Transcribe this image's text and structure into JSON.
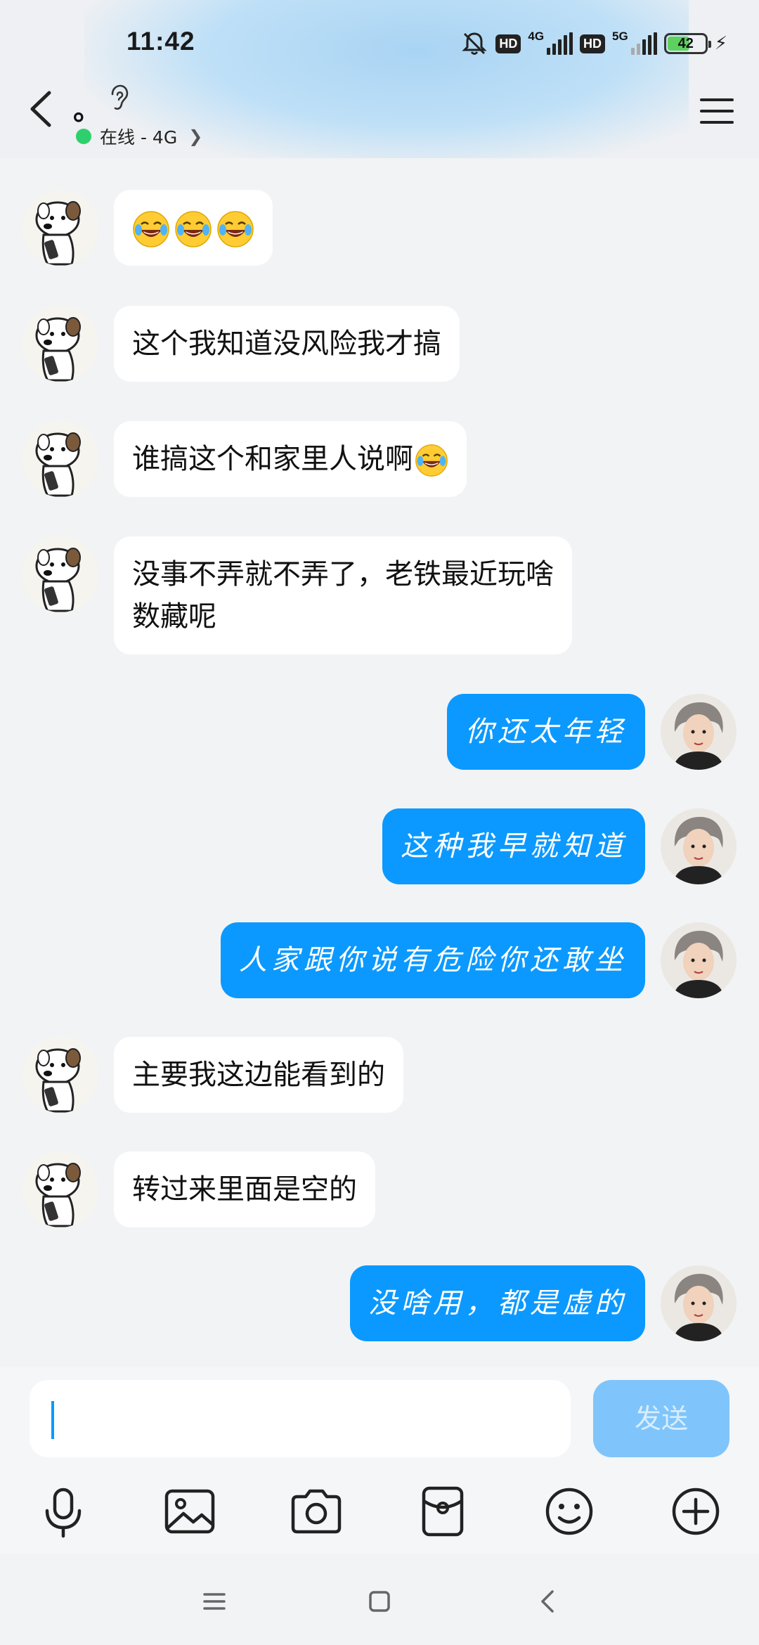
{
  "status_bar": {
    "time": "11:42",
    "hd1": "HD",
    "net1": "4G",
    "hd2": "HD",
    "net2": "5G",
    "battery": "42"
  },
  "header": {
    "title": "。",
    "presence": "在线 - 4G",
    "presence_dot_color": "#2ed06e"
  },
  "messages": [
    {
      "side": "in",
      "text": "",
      "emoji_count": 3,
      "emoji": "face-with-tears-of-joy"
    },
    {
      "side": "in",
      "text": "这个我知道没风险我才搞"
    },
    {
      "side": "in",
      "text": "谁搞这个和家里人说啊",
      "emoji": "face-with-tears-of-joy"
    },
    {
      "side": "in",
      "text": "没事不弄就不弄了，老铁最近玩啥数藏呢",
      "line1": "没事不弄就不弄了，老铁最近玩啥",
      "line2": "数藏呢"
    },
    {
      "side": "out",
      "text": "你还太年轻"
    },
    {
      "side": "out",
      "text": "这种我早就知道"
    },
    {
      "side": "out",
      "text": "人家跟你说有危险你还敢坐"
    },
    {
      "side": "in",
      "text": "主要我这边能看到的"
    },
    {
      "side": "in",
      "text": "转过来里面是空的"
    },
    {
      "side": "out",
      "text": "没啥用，都是虚的"
    }
  ],
  "composer": {
    "input_value": "",
    "send_label": "发送"
  },
  "colors": {
    "outgoing_bubble": "#0b99ff",
    "incoming_bubble": "#ffffff",
    "send_button": "#7fc5fb"
  },
  "icons": {
    "toolbar": [
      "microphone-icon",
      "image-icon",
      "camera-icon",
      "red-packet-icon",
      "emoji-icon",
      "plus-icon"
    ],
    "nav": [
      "recents-icon",
      "home-icon",
      "back-icon"
    ]
  }
}
